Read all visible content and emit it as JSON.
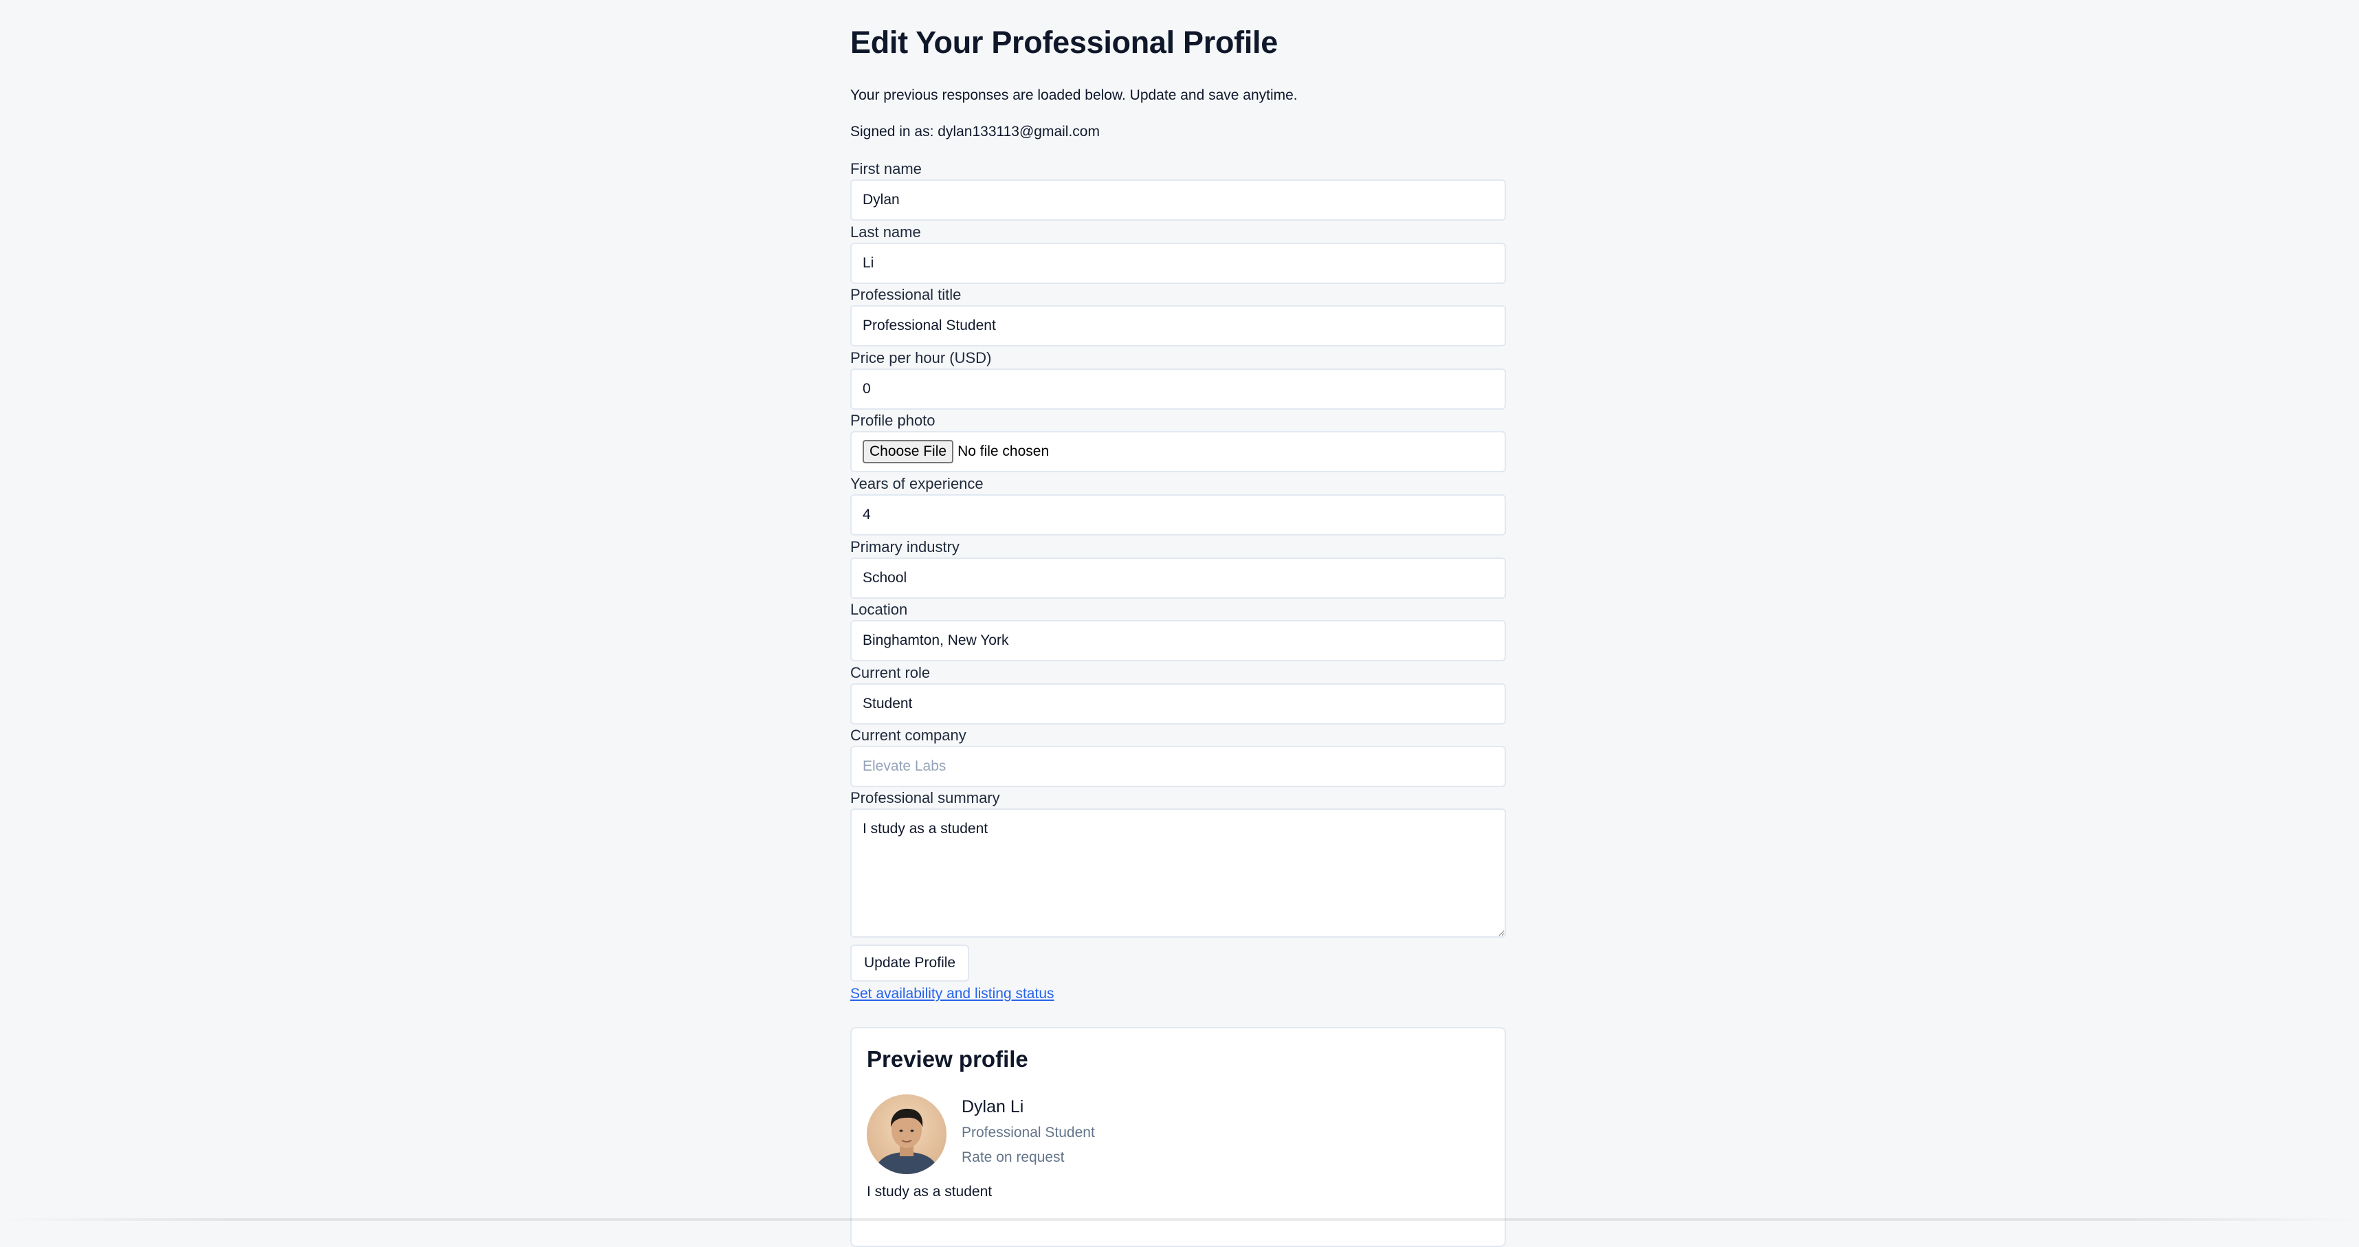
{
  "page": {
    "title": "Edit Your Professional Profile",
    "intro": "Your previous responses are loaded below. Update and save anytime.",
    "signed_in": "Signed in as: dylan133113@gmail.com"
  },
  "form": {
    "first_name": {
      "label": "First name",
      "value": "Dylan"
    },
    "last_name": {
      "label": "Last name",
      "value": "Li"
    },
    "professional_title": {
      "label": "Professional title",
      "value": "Professional Student"
    },
    "price_per_hour": {
      "label": "Price per hour (USD)",
      "value": "0"
    },
    "profile_photo": {
      "label": "Profile photo",
      "button": "Choose File",
      "status": "No file chosen"
    },
    "years_experience": {
      "label": "Years of experience",
      "value": "4"
    },
    "primary_industry": {
      "label": "Primary industry",
      "value": "School"
    },
    "location": {
      "label": "Location",
      "value": "Binghamton, New York"
    },
    "current_role": {
      "label": "Current role",
      "value": "Student"
    },
    "current_company": {
      "label": "Current company",
      "value": "",
      "placeholder": "Elevate Labs"
    },
    "professional_summary": {
      "label": "Professional summary",
      "value": "I study as a student"
    },
    "update_button": "Update Profile",
    "availability_link": "Set availability and listing status"
  },
  "preview": {
    "title": "Preview profile",
    "name": "Dylan Li",
    "title_line": "Professional Student",
    "rate": "Rate on request",
    "summary": "I study as a student"
  },
  "colors": {
    "background": "#f6f7f9",
    "link": "#2563eb",
    "muted_text": "#64748b",
    "border": "#e2e8f0"
  }
}
